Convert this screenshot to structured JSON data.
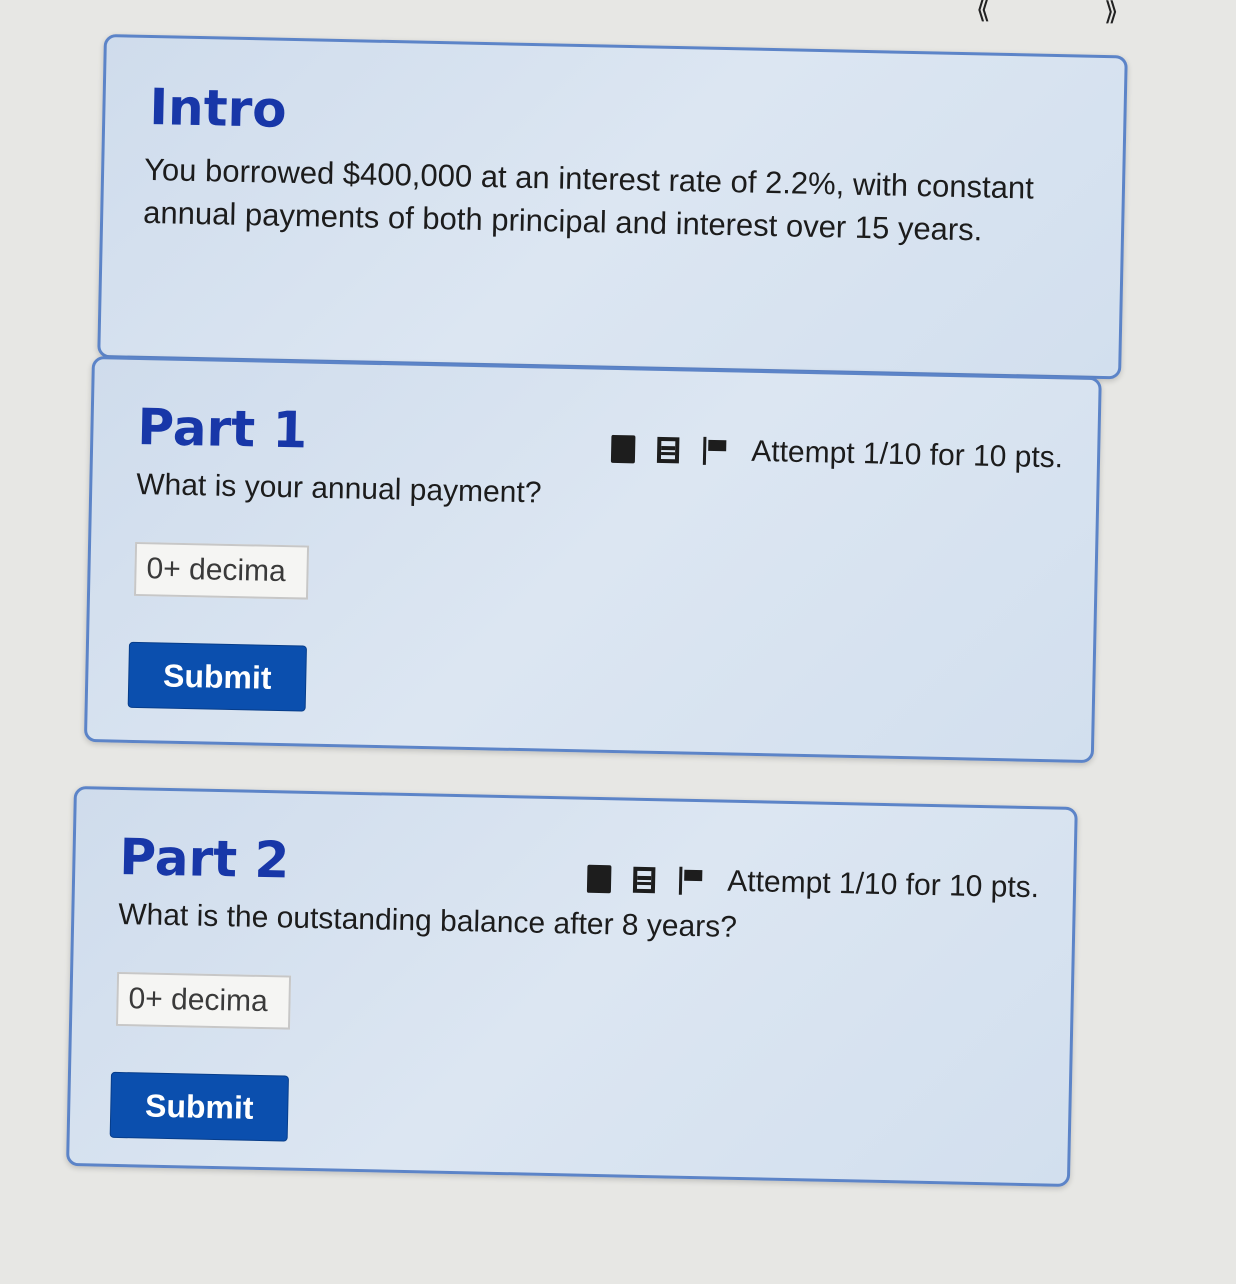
{
  "nav": {
    "back_icon": "double-chevron-left-icon",
    "forward_icon": "double-chevron-right-icon"
  },
  "intro": {
    "title": "Intro",
    "text": "You borrowed $400,000 at an interest rate of 2.2%, with constant annual payments of both principal and interest over 15 years."
  },
  "parts": [
    {
      "title": "Part 1",
      "attempt": "Attempt 1/10 for 10 pts.",
      "question": "What is your annual payment?",
      "input_placeholder": "0+ decima",
      "input_value": "",
      "submit_label": "Submit"
    },
    {
      "title": "Part 2",
      "attempt": "Attempt 1/10 for 10 pts.",
      "question": "What is the outstanding balance after 8 years?",
      "input_placeholder": "0+ decima",
      "input_value": "",
      "submit_label": "Submit"
    }
  ],
  "toolbar_icons": [
    "notes-icon",
    "calculator-icon",
    "flag-icon"
  ],
  "colors": {
    "title": "#1837a8",
    "card_border": "#5c84c8",
    "card_bg": "#d6e1ef",
    "button_bg": "#0b4fae",
    "button_text": "#ffffff",
    "page_bg": "#e7e7e4"
  }
}
